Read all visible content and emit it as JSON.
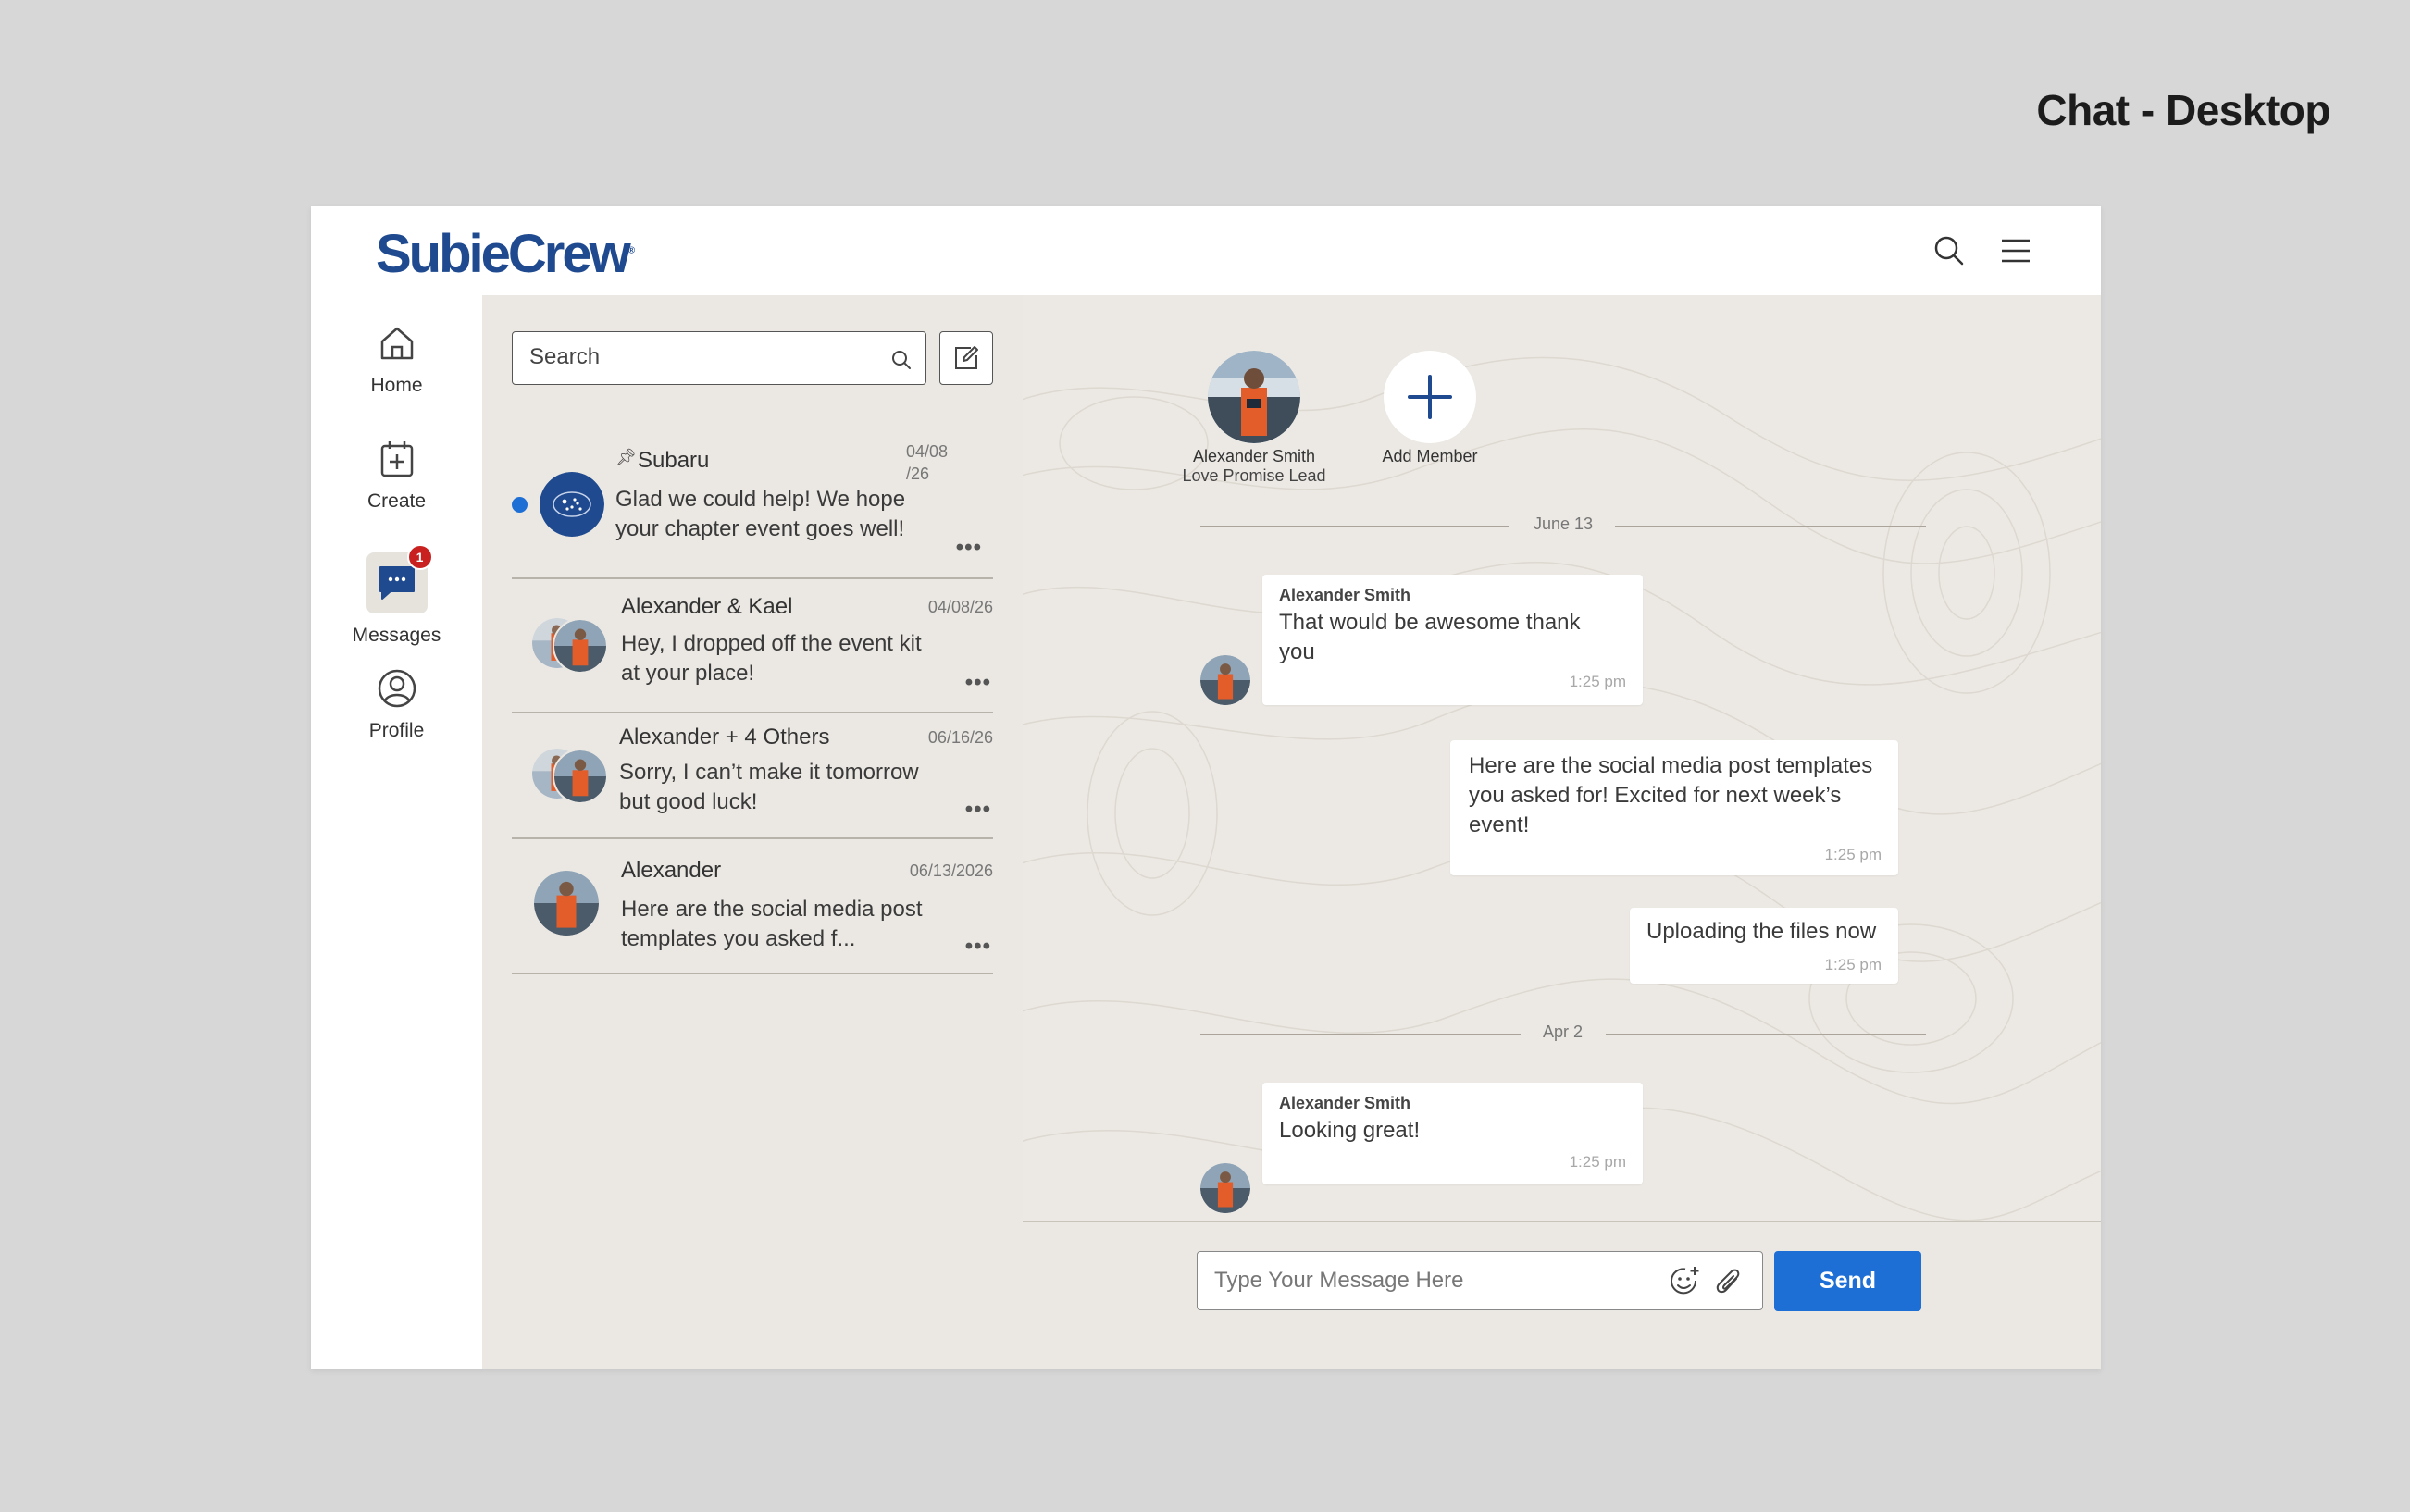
{
  "page_title": "Chat - Desktop",
  "header": {
    "logo_text": "SubieCrew",
    "logo_mark": "®",
    "search_icon": "search-icon",
    "menu_icon": "hamburger-menu-icon"
  },
  "sidebar": {
    "items": [
      {
        "label": "Home",
        "icon": "home-icon"
      },
      {
        "label": "Create",
        "icon": "calendar-plus-icon"
      },
      {
        "label": "Messages",
        "icon": "chat-bubble-icon",
        "badge": "1",
        "active": true
      },
      {
        "label": "Profile",
        "icon": "user-circle-icon"
      }
    ]
  },
  "conversation_list": {
    "search_placeholder": "Search",
    "conversations": [
      {
        "name": "Subaru",
        "pinned": true,
        "unread": true,
        "date": "04/08\n/26",
        "preview": "Glad we could help! We hope your chapter event goes well!",
        "more": "•••"
      },
      {
        "name": "Alexander & Kael",
        "date": "04/08/26",
        "preview": "Hey, I dropped off the event kit at your place!",
        "more": "•••"
      },
      {
        "name": "Alexander + 4 Others",
        "date": "06/16/26",
        "preview": "Sorry, I can’t make it tomorrow but good luck!",
        "more": "•••"
      },
      {
        "name": "Alexander",
        "date": "06/13/2026",
        "preview": "Here are the social media post templates you asked f...",
        "more": "•••"
      }
    ]
  },
  "chat": {
    "members": [
      {
        "name": "Alexander Smith",
        "role": "Love Promise Lead"
      },
      {
        "name": "Add Member"
      }
    ],
    "dividers": [
      "June 13",
      "Apr 2"
    ],
    "messages": [
      {
        "sender": "Alexander Smith",
        "text": "That would be awesome thank you",
        "time": "1:25 pm",
        "incoming": true
      },
      {
        "text": "Here are the social media post templates you asked for! Excited for next week’s event!",
        "time": "1:25 pm",
        "incoming": false
      },
      {
        "text": "Uploading the files now",
        "time": "1:25 pm",
        "incoming": false
      },
      {
        "sender": "Alexander Smith",
        "text": "Looking great!",
        "time": "1:25 pm",
        "incoming": true
      }
    ],
    "composer": {
      "placeholder": "Type Your Message Here",
      "emoji_icon": "emoji-add-icon",
      "attach_icon": "paperclip-icon",
      "send_label": "Send"
    }
  },
  "colors": {
    "brand_blue": "#1f4a8f",
    "accent_blue": "#1d6fd6",
    "badge_red": "#c8211f",
    "pane_bg": "#ebe8e3"
  }
}
